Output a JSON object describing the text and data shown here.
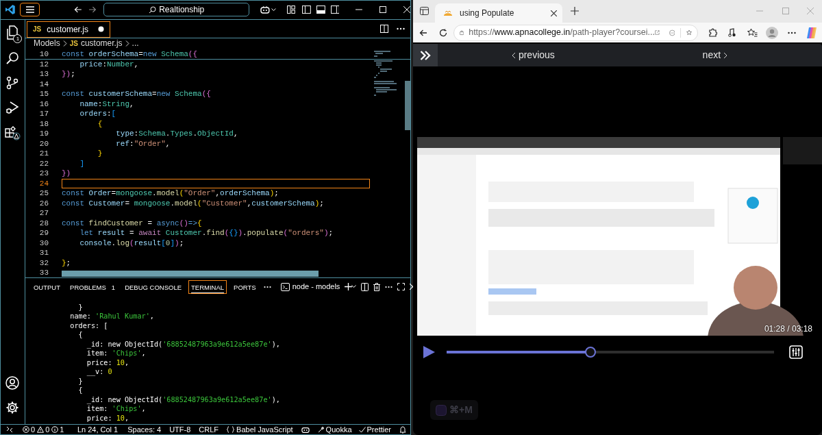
{
  "vscode": {
    "title_bar": {
      "search": "Realtionship"
    },
    "activity_bar": {
      "explorer_badge": "1"
    },
    "editor_tabs": [
      {
        "file_icon": "JS",
        "label": "customer.js",
        "modified": true,
        "selected": true
      }
    ],
    "breadcrumb": {
      "folder": "Models",
      "file_icon": "JS",
      "file": "customer.js",
      "more": "..."
    },
    "editor": {
      "sticky_line": {
        "number": "10",
        "segments": [
          {
            "text": "const",
            "kind": "keyword"
          },
          {
            "text": " orderSchema",
            "kind": "variable"
          },
          {
            "text": "=",
            "kind": "plain"
          },
          {
            "text": "new",
            "kind": "keyword"
          },
          {
            "text": " Schema",
            "kind": "type"
          },
          {
            "text": "({",
            "kind": "bracket2"
          }
        ]
      },
      "lines": [
        {
          "number": "12",
          "current": false,
          "segments": [
            {
              "text": "    price",
              "kind": "variable"
            },
            {
              "text": ":",
              "kind": "plain"
            },
            {
              "text": "Number",
              "kind": "type"
            },
            {
              "text": ",",
              "kind": "plain"
            }
          ]
        },
        {
          "number": "13",
          "current": false,
          "segments": [
            {
              "text": "})",
              "kind": "bracket2"
            },
            {
              "text": ";",
              "kind": "plain"
            }
          ]
        },
        {
          "number": "14",
          "current": false
        },
        {
          "number": "15",
          "current": false,
          "segments": [
            {
              "text": "const",
              "kind": "keyword"
            },
            {
              "text": " customerSchema",
              "kind": "variable"
            },
            {
              "text": "=",
              "kind": "plain"
            },
            {
              "text": "new",
              "kind": "keyword"
            },
            {
              "text": " Schema",
              "kind": "type"
            },
            {
              "text": "({",
              "kind": "bracket2"
            }
          ]
        },
        {
          "number": "16",
          "current": false,
          "segments": [
            {
              "text": "    name",
              "kind": "variable"
            },
            {
              "text": ":",
              "kind": "plain"
            },
            {
              "text": "String",
              "kind": "type"
            },
            {
              "text": ",",
              "kind": "plain"
            }
          ]
        },
        {
          "number": "17",
          "current": false,
          "segments": [
            {
              "text": "    orders",
              "kind": "variable"
            },
            {
              "text": ":",
              "kind": "plain"
            },
            {
              "text": "[",
              "kind": "bracket3"
            }
          ]
        },
        {
          "number": "18",
          "current": false,
          "segments": [
            {
              "text": "        {",
              "kind": "bracket1"
            }
          ]
        },
        {
          "number": "19",
          "current": false,
          "segments": [
            {
              "text": "            type",
              "kind": "variable"
            },
            {
              "text": ":",
              "kind": "plain"
            },
            {
              "text": "Schema",
              "kind": "type"
            },
            {
              "text": ".",
              "kind": "plain"
            },
            {
              "text": "Types",
              "kind": "type"
            },
            {
              "text": ".",
              "kind": "plain"
            },
            {
              "text": "ObjectId",
              "kind": "type"
            },
            {
              "text": ",",
              "kind": "plain"
            }
          ]
        },
        {
          "number": "20",
          "current": false,
          "segments": [
            {
              "text": "            ref",
              "kind": "variable"
            },
            {
              "text": ":",
              "kind": "plain"
            },
            {
              "text": "\"Order\"",
              "kind": "string"
            },
            {
              "text": ",",
              "kind": "plain"
            }
          ]
        },
        {
          "number": "21",
          "current": false,
          "segments": [
            {
              "text": "        }",
              "kind": "bracket1"
            }
          ]
        },
        {
          "number": "22",
          "current": false,
          "segments": [
            {
              "text": "    ]",
              "kind": "bracket3"
            }
          ]
        },
        {
          "number": "23",
          "current": false,
          "segments": [
            {
              "text": "})",
              "kind": "bracket2"
            }
          ]
        },
        {
          "number": "24",
          "current": true
        },
        {
          "number": "25",
          "current": false,
          "segments": [
            {
              "text": "const",
              "kind": "keyword"
            },
            {
              "text": " Order",
              "kind": "variable"
            },
            {
              "text": "=",
              "kind": "plain"
            },
            {
              "text": "mongoose",
              "kind": "type"
            },
            {
              "text": ".",
              "kind": "plain"
            },
            {
              "text": "model",
              "kind": "function"
            },
            {
              "text": "(",
              "kind": "bracket1"
            },
            {
              "text": "\"Order\"",
              "kind": "string"
            },
            {
              "text": ",",
              "kind": "plain"
            },
            {
              "text": "orderSchema",
              "kind": "variable"
            },
            {
              "text": ")",
              "kind": "bracket1"
            },
            {
              "text": ";",
              "kind": "plain"
            }
          ]
        },
        {
          "number": "26",
          "current": false,
          "segments": [
            {
              "text": "const",
              "kind": "keyword"
            },
            {
              "text": " Customer",
              "kind": "variable"
            },
            {
              "text": "= ",
              "kind": "plain"
            },
            {
              "text": "mongoose",
              "kind": "type"
            },
            {
              "text": ".",
              "kind": "plain"
            },
            {
              "text": "model",
              "kind": "function"
            },
            {
              "text": "(",
              "kind": "bracket1"
            },
            {
              "text": "\"Customer\"",
              "kind": "string"
            },
            {
              "text": ",",
              "kind": "plain"
            },
            {
              "text": "customerSchema",
              "kind": "variable"
            },
            {
              "text": ")",
              "kind": "bracket1"
            },
            {
              "text": ";",
              "kind": "plain"
            }
          ]
        },
        {
          "number": "27",
          "current": false
        },
        {
          "number": "28",
          "current": false,
          "segments": [
            {
              "text": "const",
              "kind": "keyword"
            },
            {
              "text": " findCustomer",
              "kind": "function"
            },
            {
              "text": " = ",
              "kind": "plain"
            },
            {
              "text": "async",
              "kind": "keyword"
            },
            {
              "text": "()",
              "kind": "bracket2"
            },
            {
              "text": "=>",
              "kind": "keyword"
            },
            {
              "text": "{",
              "kind": "bracket1"
            }
          ]
        },
        {
          "number": "29",
          "current": false,
          "segments": [
            {
              "text": "    let",
              "kind": "keyword"
            },
            {
              "text": " result",
              "kind": "variable"
            },
            {
              "text": " = ",
              "kind": "plain"
            },
            {
              "text": "await",
              "kind": "control"
            },
            {
              "text": " Customer",
              "kind": "type"
            },
            {
              "text": ".",
              "kind": "plain"
            },
            {
              "text": "find",
              "kind": "function"
            },
            {
              "text": "(",
              "kind": "bracket2"
            },
            {
              "text": "{}",
              "kind": "bracket3"
            },
            {
              "text": ")",
              "kind": "bracket2"
            },
            {
              "text": ".",
              "kind": "plain"
            },
            {
              "text": "populate",
              "kind": "function"
            },
            {
              "text": "(",
              "kind": "bracket2"
            },
            {
              "text": "\"orders\"",
              "kind": "string"
            },
            {
              "text": ")",
              "kind": "bracket2"
            },
            {
              "text": ";",
              "kind": "plain"
            }
          ]
        },
        {
          "number": "30",
          "current": false,
          "segments": [
            {
              "text": "    console",
              "kind": "variable"
            },
            {
              "text": ".",
              "kind": "plain"
            },
            {
              "text": "log",
              "kind": "function"
            },
            {
              "text": "(",
              "kind": "bracket2"
            },
            {
              "text": "result",
              "kind": "variable"
            },
            {
              "text": "[",
              "kind": "bracket3"
            },
            {
              "text": "0",
              "kind": "number"
            },
            {
              "text": "]",
              "kind": "bracket3"
            },
            {
              "text": ")",
              "kind": "bracket2"
            },
            {
              "text": ";",
              "kind": "plain"
            }
          ]
        },
        {
          "number": "31",
          "current": false
        },
        {
          "number": "32",
          "current": false,
          "segments": [
            {
              "text": "}",
              "kind": "bracket1"
            },
            {
              "text": ";",
              "kind": "plain"
            }
          ]
        },
        {
          "number": "33",
          "current": false
        }
      ]
    },
    "panel": {
      "tabs": [
        {
          "label": "OUTPUT",
          "selected": false
        },
        {
          "label": "PROBLEMS",
          "badge": "1",
          "selected": false
        },
        {
          "label": "DEBUG CONSOLE",
          "selected": false
        },
        {
          "label": "TERMINAL",
          "selected": true
        },
        {
          "label": "PORTS",
          "selected": false
        }
      ],
      "terminal_name": "node - models",
      "terminal_lines": [
        [
          {
            "text": "    }",
            "kind": "plain"
          }
        ],
        [
          {
            "text": "  name: ",
            "kind": "plain"
          },
          {
            "text": "'Rahul Kumar'",
            "kind": "string"
          },
          {
            "text": ",",
            "kind": "plain"
          }
        ],
        [
          {
            "text": "  orders: [",
            "kind": "plain"
          }
        ],
        [
          {
            "text": "    {",
            "kind": "plain"
          }
        ],
        [
          {
            "text": "      _id: new ObjectId(",
            "kind": "plain"
          },
          {
            "text": "'68852487963a9e612a5ee87e'",
            "kind": "string"
          },
          {
            "text": "),",
            "kind": "plain"
          }
        ],
        [
          {
            "text": "      item: ",
            "kind": "plain"
          },
          {
            "text": "'Chips'",
            "kind": "string"
          },
          {
            "text": ",",
            "kind": "plain"
          }
        ],
        [
          {
            "text": "      price: ",
            "kind": "plain"
          },
          {
            "text": "10",
            "kind": "number"
          },
          {
            "text": ",",
            "kind": "plain"
          }
        ],
        [
          {
            "text": "      __v: ",
            "kind": "plain"
          },
          {
            "text": "0",
            "kind": "number"
          }
        ],
        [
          {
            "text": "    }",
            "kind": "plain"
          }
        ],
        [
          {
            "text": "    {",
            "kind": "plain"
          }
        ],
        [
          {
            "text": "      _id: new ObjectId(",
            "kind": "plain"
          },
          {
            "text": "'68852487963a9e612a5ee87e'",
            "kind": "string"
          },
          {
            "text": "),",
            "kind": "plain"
          }
        ],
        [
          {
            "text": "      item: ",
            "kind": "plain"
          },
          {
            "text": "'Chips'",
            "kind": "string"
          },
          {
            "text": ",",
            "kind": "plain"
          }
        ],
        [
          {
            "text": "      price: ",
            "kind": "plain"
          },
          {
            "text": "10",
            "kind": "number"
          },
          {
            "text": ",",
            "kind": "plain"
          }
        ]
      ]
    },
    "status_bar": {
      "errors": "0",
      "warnings": "0",
      "infos": "1",
      "position": "Ln 24, Col 1",
      "indent": "Spaces: 4",
      "encoding": "UTF-8",
      "eol": "CRLF",
      "language": "Babel JavaScript",
      "quokka": "Quokka",
      "prettier": "Prettier"
    }
  },
  "browser": {
    "tabs": [
      {
        "title": "using Populate",
        "selected": true
      }
    ],
    "address": {
      "scheme": "https://",
      "domain": "www.apnacollege.in",
      "path": "/path-player?coursei..."
    },
    "page": {
      "previous": "previous",
      "next": "next",
      "video": {
        "kind": "picture",
        "time": "01:28 / 03:18",
        "level": 0.44,
        "shortcut": "⌘+M"
      }
    }
  }
}
